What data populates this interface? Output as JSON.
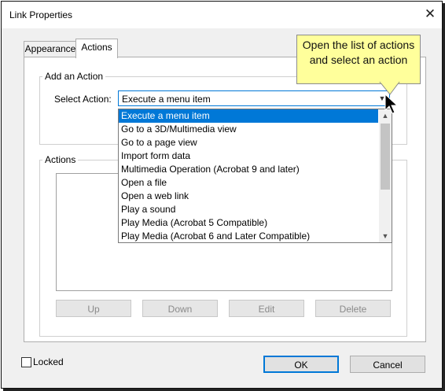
{
  "window": {
    "title": "Link Properties"
  },
  "tabs": [
    {
      "label": "Appearance"
    },
    {
      "label": "Actions"
    }
  ],
  "add_action": {
    "legend": "Add an Action",
    "select_label": "Select Action:",
    "selected_value": "Execute a menu item"
  },
  "dropdown": {
    "options": [
      "Execute a menu item",
      "Go to a 3D/Multimedia view",
      "Go to a page view",
      "Import form data",
      "Multimedia Operation (Acrobat 9 and later)",
      "Open a file",
      "Open a web link",
      "Play a sound",
      "Play Media (Acrobat 5 Compatible)",
      "Play Media (Acrobat 6 and Later Compatible)"
    ]
  },
  "actions": {
    "legend": "Actions",
    "buttons": {
      "up": "Up",
      "down": "Down",
      "edit": "Edit",
      "delete": "Delete"
    }
  },
  "footer": {
    "locked_label": "Locked",
    "ok": "OK",
    "cancel": "Cancel"
  },
  "callout": {
    "text": "Open the list of actions and select an action"
  },
  "colors": {
    "accent": "#0078d7",
    "callout_fill": "#ffff9b"
  }
}
